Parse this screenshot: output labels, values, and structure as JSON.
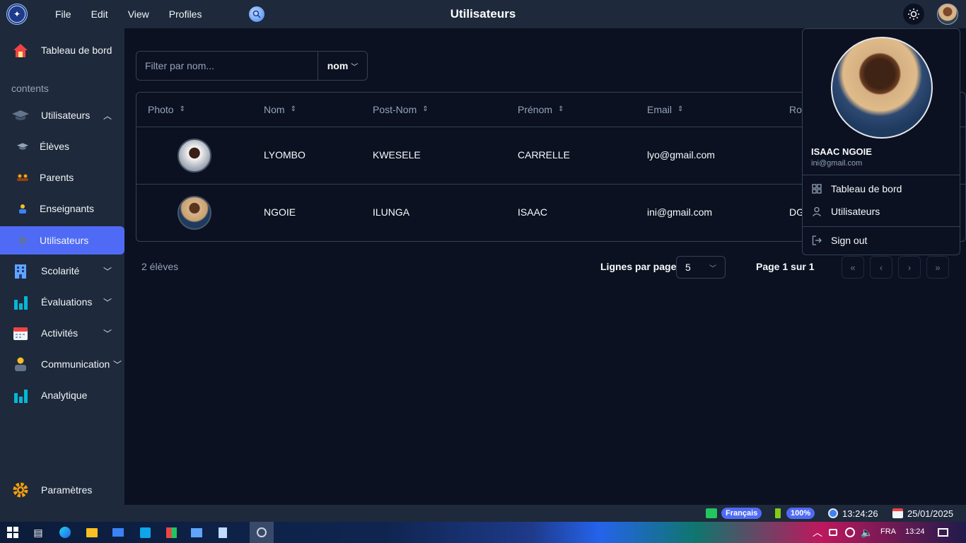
{
  "app": {
    "title": "Utilisateurs",
    "menu": [
      "File",
      "Edit",
      "View",
      "Profiles"
    ]
  },
  "sidebar": {
    "dashboard": "Tableau de bord",
    "section": "contents",
    "utilisateurs": "Utilisateurs",
    "sub": [
      "Élèves",
      "Parents",
      "Enseignants",
      "Utilisateurs"
    ],
    "scolarite": "Scolarité",
    "evaluations": "Évaluations",
    "activites": "Activités",
    "communication": "Communication",
    "analytique": "Analytique",
    "parametres": "Paramètres"
  },
  "filter": {
    "placeholder": "Filter par nom...",
    "select": "nom"
  },
  "table": {
    "headers": [
      "Photo",
      "Nom",
      "Post-Nom",
      "Prénom",
      "Email",
      "Rol"
    ],
    "rows": [
      {
        "nom": "LYOMBO",
        "postnom": "KWESELE",
        "prenom": "CARRELLE",
        "email": "lyo@gmail.com",
        "role": ""
      },
      {
        "nom": "NGOIE",
        "postnom": "ILUNGA",
        "prenom": "ISAAC",
        "email": "ini@gmail.com",
        "role": "DG"
      }
    ]
  },
  "footer": {
    "count": "2 élèves",
    "rows_label": "Lignes par page",
    "rows_value": "5",
    "page_info": "Page 1 sur 1"
  },
  "profile_menu": {
    "name": "ISAAC NGOIE",
    "email": "ini@gmail.com",
    "items": [
      "Tableau de bord",
      "Utilisateurs"
    ],
    "signout": "Sign out"
  },
  "statusbar": {
    "language": "Français",
    "battery": "100%",
    "time": "13:24:26",
    "date": "25/01/2025"
  },
  "taskbar": {
    "lang": "FRA",
    "clock": "13:24"
  },
  "colors": {
    "accent": "#4f6bf5",
    "background": "#0b1121",
    "panel": "#1e293b"
  }
}
